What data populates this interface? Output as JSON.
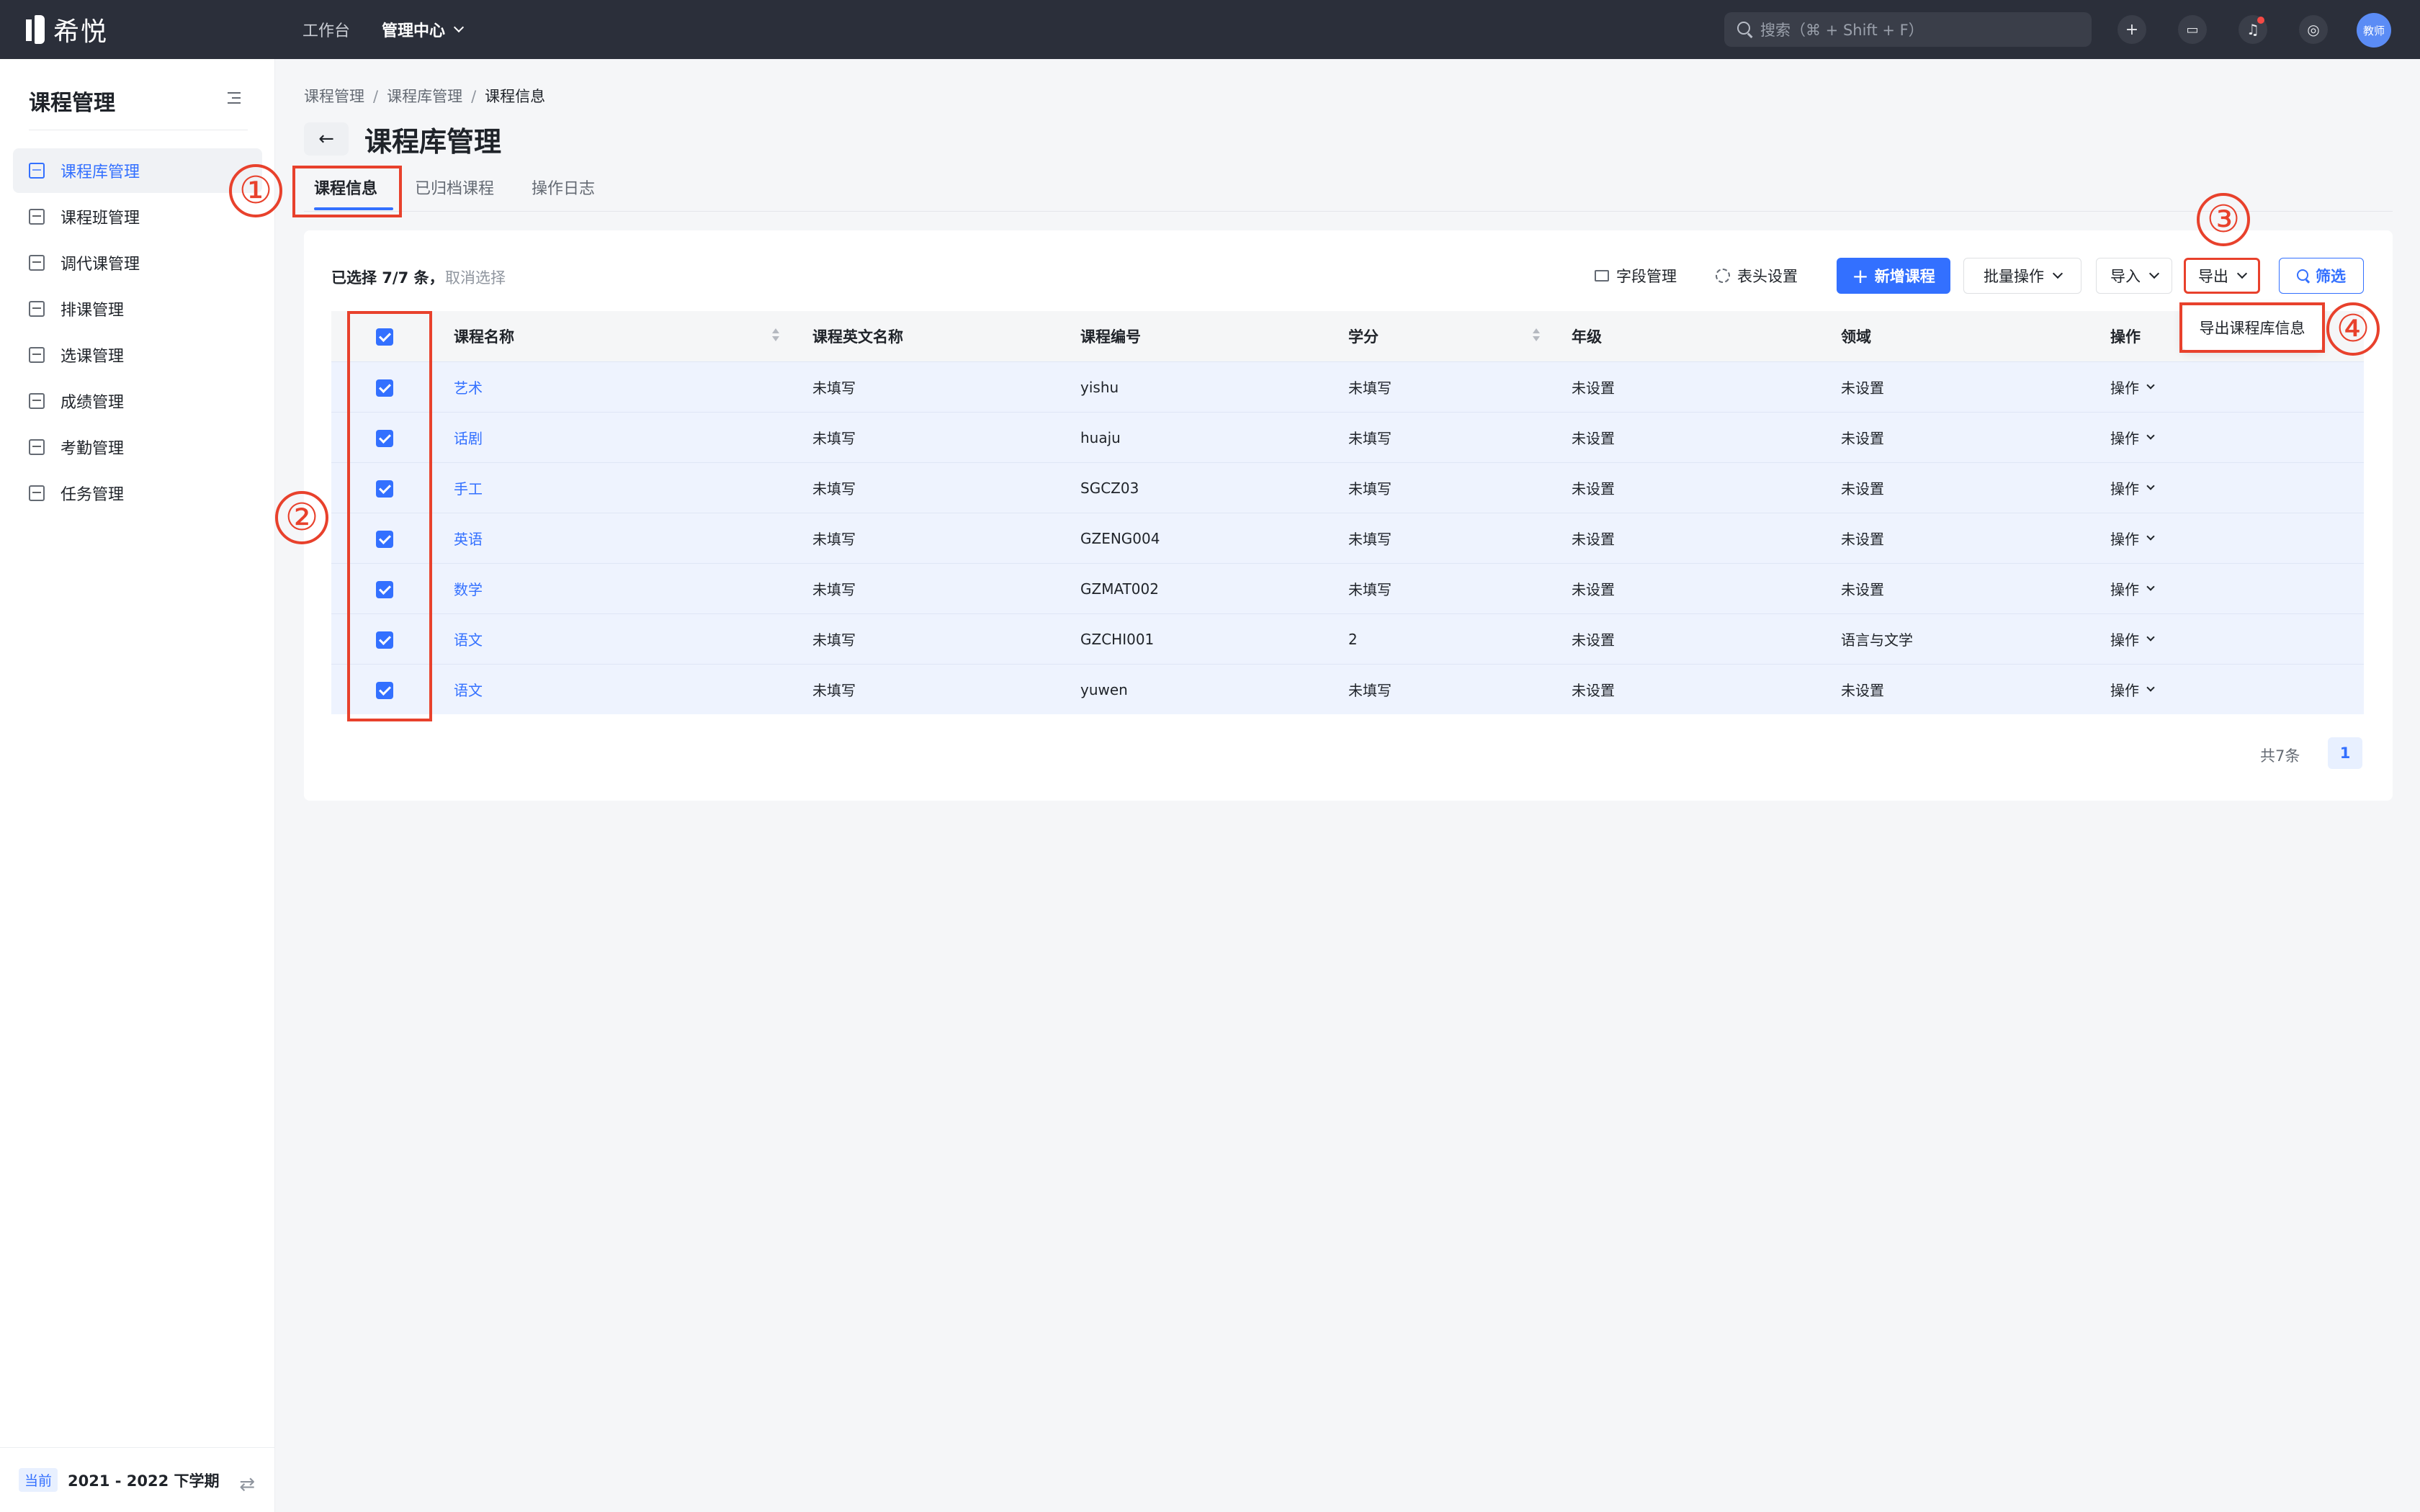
{
  "app": {
    "logo_text": "希悦"
  },
  "topnav": {
    "items": [
      "工作台",
      "管理中心"
    ]
  },
  "search": {
    "placeholder": "搜索（⌘ + Shift + F）"
  },
  "user": {
    "avatar_label": "教师"
  },
  "sidebar": {
    "title": "课程管理",
    "items": [
      {
        "label": "课程库管理",
        "active": true
      },
      {
        "label": "课程班管理"
      },
      {
        "label": "调代课管理"
      },
      {
        "label": "排课管理"
      },
      {
        "label": "选课管理"
      },
      {
        "label": "成绩管理"
      },
      {
        "label": "考勤管理"
      },
      {
        "label": "任务管理"
      }
    ],
    "footer": {
      "badge": "当前",
      "term": "2021 - 2022 下学期"
    }
  },
  "breadcrumb": [
    "课程管理",
    "课程库管理",
    "课程信息"
  ],
  "page": {
    "title": "课程库管理"
  },
  "tabs": [
    "课程信息",
    "已归档课程",
    "操作日志"
  ],
  "selection": {
    "info": "已选择 7/7 条，",
    "cancel": "取消选择"
  },
  "toolbar": {
    "field_manage": "字段管理",
    "header_settings": "表头设置",
    "add_course": "新增课程",
    "batch_ops": "批量操作",
    "import": "导入",
    "export": "导出",
    "filter": "筛选"
  },
  "export_menu": {
    "item": "导出课程库信息"
  },
  "table": {
    "columns": [
      "课程名称",
      "课程英文名称",
      "课程编号",
      "学分",
      "年级",
      "领域",
      "操作"
    ],
    "rows": [
      [
        "艺术",
        "未填写",
        "yishu",
        "未填写",
        "未设置",
        "未设置",
        "操作"
      ],
      [
        "话剧",
        "未填写",
        "huaju",
        "未填写",
        "未设置",
        "未设置",
        "操作"
      ],
      [
        "手工",
        "未填写",
        "SGCZ03",
        "未填写",
        "未设置",
        "未设置",
        "操作"
      ],
      [
        "英语",
        "未填写",
        "GZENG004",
        "未填写",
        "未设置",
        "未设置",
        "操作"
      ],
      [
        "数学",
        "未填写",
        "GZMAT002",
        "未填写",
        "未设置",
        "未设置",
        "操作"
      ],
      [
        "语文",
        "未填写",
        "GZCHI001",
        "2",
        "未设置",
        "语言与文学",
        "操作"
      ],
      [
        "语文",
        "未填写",
        "yuwen",
        "未填写",
        "未设置",
        "未设置",
        "操作"
      ]
    ]
  },
  "pagination": {
    "total": "共7条",
    "current_page": "1"
  },
  "annotations": [
    "①",
    "②",
    "③",
    "④"
  ],
  "colors": {
    "accent": "#3370ff",
    "topbar": "#2b2f3a",
    "annotation": "#e8412c"
  }
}
